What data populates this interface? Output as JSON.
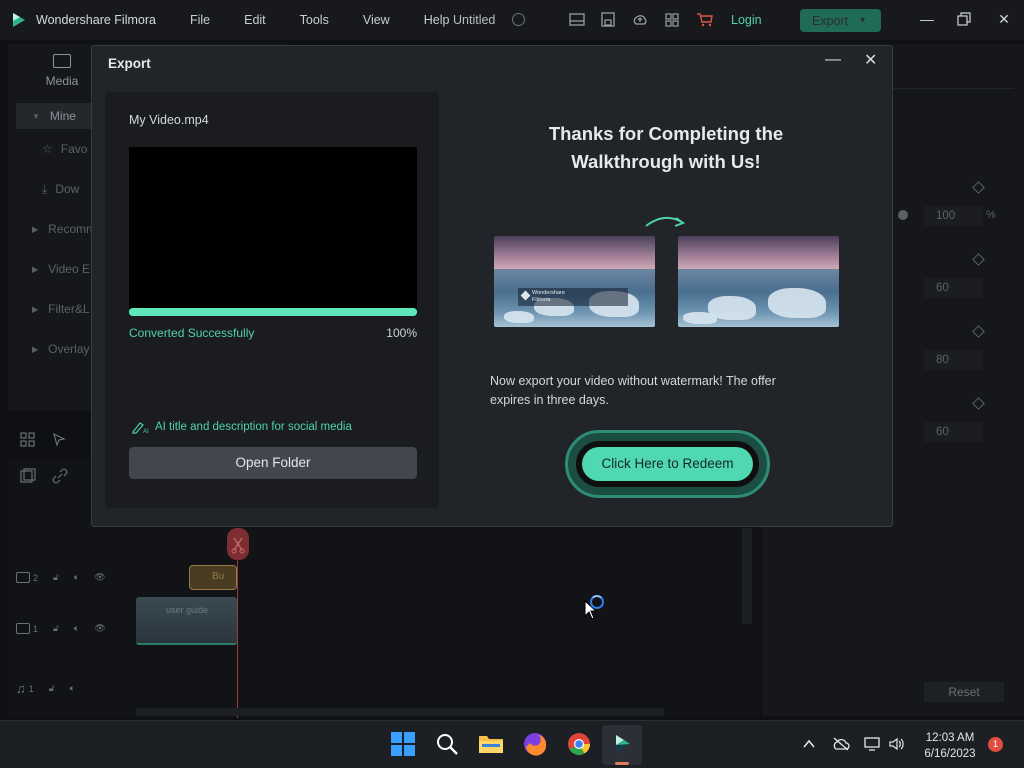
{
  "app": {
    "name": "Wondershare Filmora",
    "menu": [
      "File",
      "Edit",
      "Tools",
      "View",
      "Help"
    ],
    "doc_title": "Untitled",
    "login": "Login",
    "export": "Export"
  },
  "left_panel": {
    "media_tab": "Media",
    "items": [
      {
        "label": "Mine",
        "active": true
      },
      {
        "label": "Favo"
      },
      {
        "label": "Dow"
      },
      {
        "label": "Recomm"
      },
      {
        "label": "Video E"
      },
      {
        "label": "Filter&L"
      },
      {
        "label": "Overlay"
      }
    ]
  },
  "right_panel": {
    "values": [
      "100",
      "60",
      "80",
      "60"
    ],
    "unit": "%",
    "reset": "Reset"
  },
  "timeline": {
    "tracks": [
      {
        "num": "2"
      },
      {
        "num": "1"
      },
      {
        "num": "1"
      }
    ],
    "title_clip": "Bu",
    "video_clip": "user guide"
  },
  "dialog": {
    "title": "Export",
    "file_name": "My Video.mp4",
    "progress_percent": 100,
    "status": "Converted Successfully",
    "percent_label": "100%",
    "ai_text": "AI title and description for social media",
    "open_folder": "Open Folder",
    "thanks_line1": "Thanks for Completing the",
    "thanks_line2": "Walkthrough with Us!",
    "watermark_line1": "Wondershare",
    "watermark_line2": "Filmora",
    "offer_line1": "Now export your video without watermark! The offer",
    "offer_line2": "expires in three days.",
    "redeem": "Click Here to Redeem"
  },
  "taskbar": {
    "time": "12:03 AM",
    "date": "6/16/2023",
    "notifications": "1"
  },
  "colors": {
    "accent": "#4fd3a8",
    "dialog_bg": "#212428",
    "card_bg": "#1a1c1f"
  }
}
